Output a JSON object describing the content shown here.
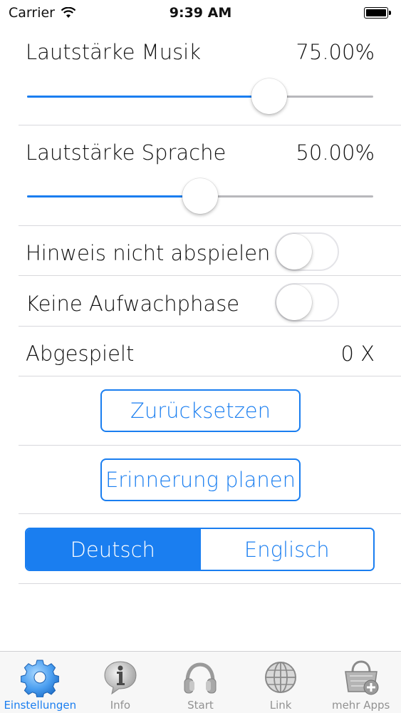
{
  "status_bar": {
    "carrier": "Carrier",
    "time": "9:39 AM"
  },
  "settings": {
    "music_volume": {
      "label": "Lautstärke Musik",
      "value_text": "75.00%",
      "fraction": 0.7
    },
    "speech_volume": {
      "label": "Lautstärke Sprache",
      "value_text": "50.00%",
      "fraction": 0.5
    },
    "hint_toggle": {
      "label": "Hinweis nicht abspielen",
      "on": false
    },
    "wakeup_toggle": {
      "label": "Keine Aufwachphase",
      "on": false
    },
    "played": {
      "label": "Abgespielt",
      "value": "0 X"
    },
    "reset_button": "Zurücksetzen",
    "reminder_button": "Erinnerung planen",
    "language": {
      "options": [
        "Deutsch",
        "Englisch"
      ],
      "selected": "Deutsch"
    }
  },
  "tabbar": {
    "tabs": [
      {
        "label": "Einstellungen",
        "icon": "gear-icon",
        "active": true
      },
      {
        "label": "Info",
        "icon": "info-icon",
        "active": false
      },
      {
        "label": "Start",
        "icon": "headphones-icon",
        "active": false
      },
      {
        "label": "Link",
        "icon": "globe-icon",
        "active": false
      },
      {
        "label": "mehr Apps",
        "icon": "basket-add-icon",
        "active": false
      }
    ]
  },
  "colors": {
    "accent": "#1a7ef0",
    "separator": "#d8d8dc",
    "tab_inactive": "#929292"
  }
}
